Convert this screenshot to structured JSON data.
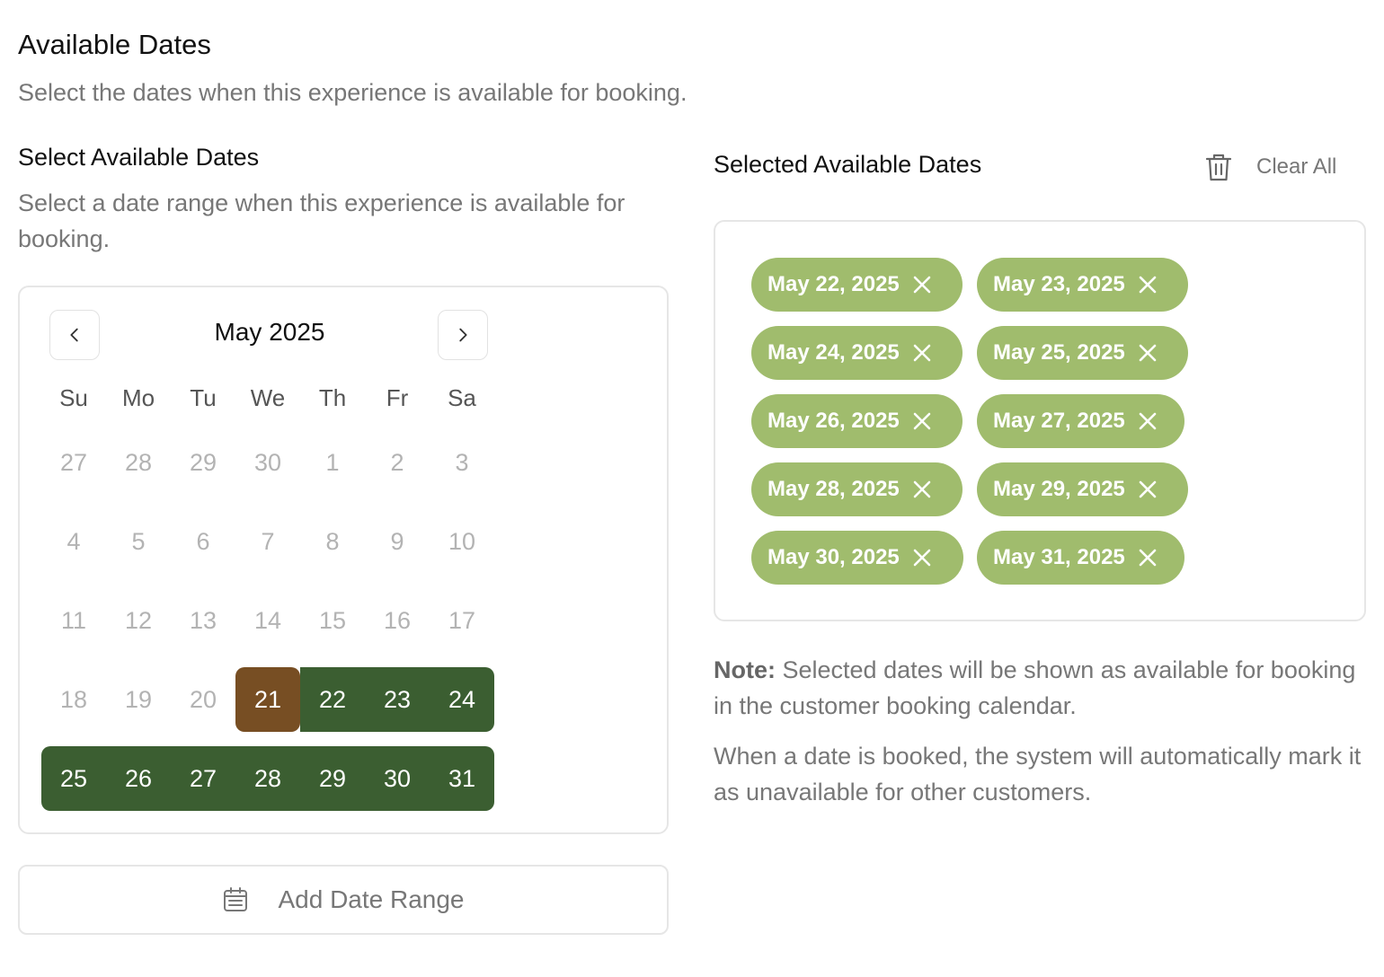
{
  "header": {
    "title": "Available Dates",
    "subtitle": "Select the dates when this experience is available for booking."
  },
  "picker": {
    "title": "Select Available Dates",
    "description": "Select a date range when this experience is available for booking.",
    "month_label": "May 2025",
    "weekdays": [
      "Su",
      "Mo",
      "Tu",
      "We",
      "Th",
      "Fr",
      "Sa"
    ],
    "weeks": [
      [
        "27",
        "28",
        "29",
        "30",
        "1",
        "2",
        "3"
      ],
      [
        "4",
        "5",
        "6",
        "7",
        "8",
        "9",
        "10"
      ],
      [
        "11",
        "12",
        "13",
        "14",
        "15",
        "16",
        "17"
      ],
      [
        "18",
        "19",
        "20",
        "21",
        "22",
        "23",
        "24"
      ],
      [
        "25",
        "26",
        "27",
        "28",
        "29",
        "30",
        "31"
      ]
    ],
    "range_start": "21",
    "range_end": "31",
    "add_button_label": "Add Date Range"
  },
  "selected": {
    "title": "Selected Available Dates",
    "clear_label": "Clear All",
    "dates": [
      "May 22, 2025",
      "May 23, 2025",
      "May 24, 2025",
      "May 25, 2025",
      "May 26, 2025",
      "May 27, 2025",
      "May 28, 2025",
      "May 29, 2025",
      "May 30, 2025",
      "May 31, 2025"
    ]
  },
  "notes": {
    "note_label": "Note:",
    "note_text": " Selected dates will be shown as available for booking in the customer booking calendar.",
    "second": "When a date is booked, the system will automatically mark it as unavailable for other customers."
  },
  "colors": {
    "range_start": "#774e23",
    "range_fill": "#3b5e31",
    "chip": "#a0bc6d"
  }
}
